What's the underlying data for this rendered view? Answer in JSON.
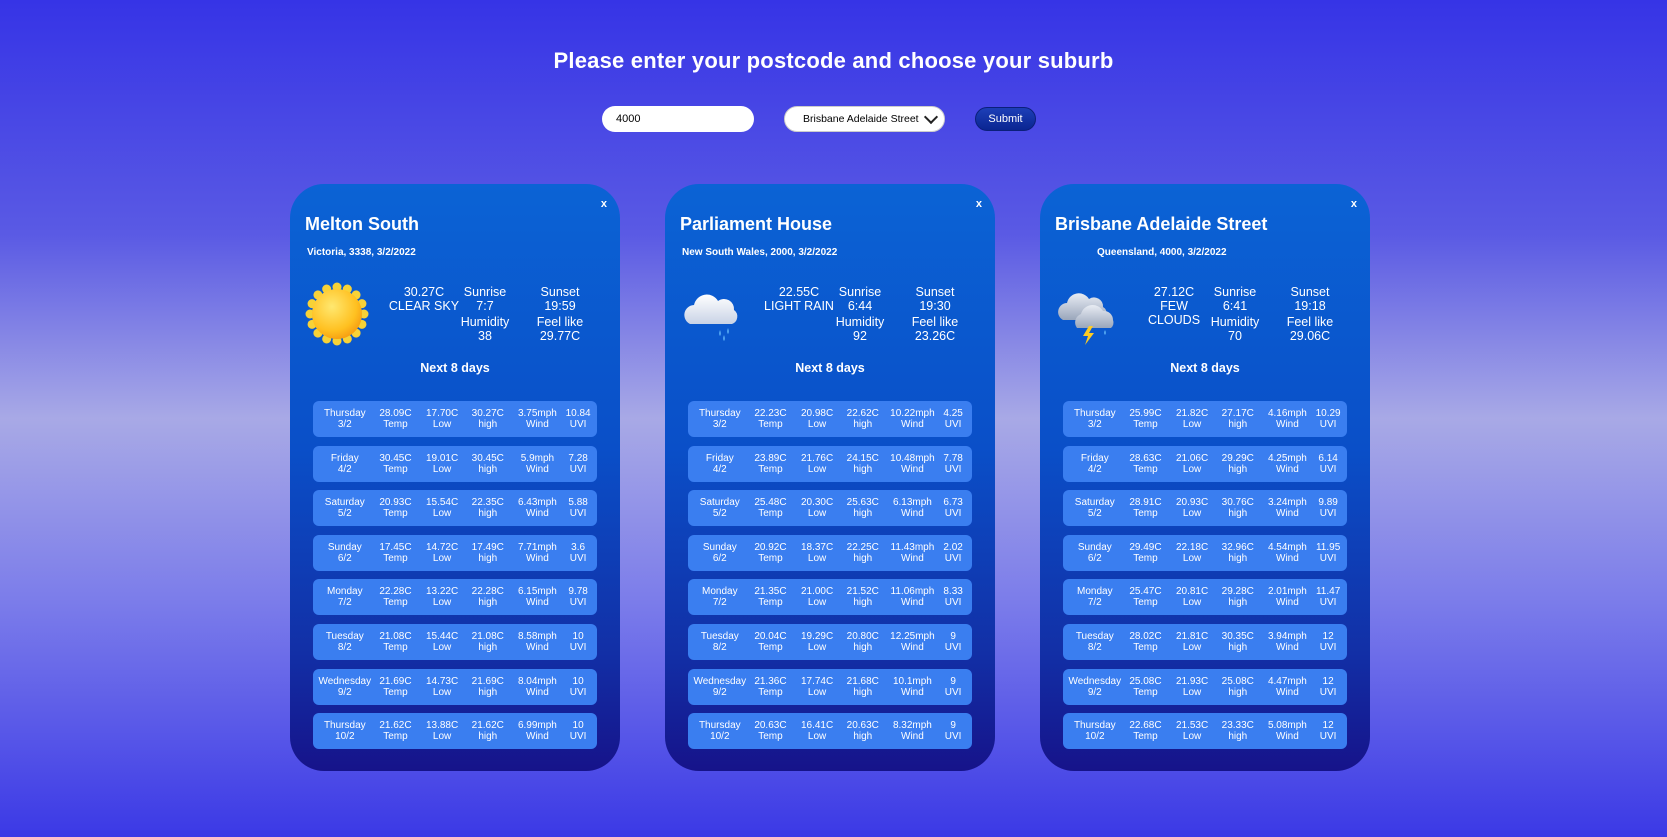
{
  "heading": "Please enter your postcode and choose your suburb",
  "form": {
    "postcode_value": "4000",
    "suburb_selected": "Brisbane Adelaide Street",
    "submit_label": "Submit"
  },
  "labels": {
    "next_title": "Next 8 days",
    "sunrise": "Sunrise",
    "sunset": "Sunset",
    "humidity": "Humidity",
    "feel_like": "Feel like",
    "close": "x",
    "temp": "Temp",
    "low": "Low",
    "high": "high",
    "wind": "Wind",
    "uvi": "UVI"
  },
  "cards": [
    {
      "city": "Melton South",
      "meta": "Victoria, 3338, 3/2/2022",
      "icon": "sun-icon",
      "temp": "30.27C",
      "desc": "CLEAR SKY",
      "sunrise": "7:7",
      "sunset": "19:59",
      "humidity": "38",
      "feel_like": "29.77C",
      "days": [
        {
          "day": "Thursday",
          "date": "3/2",
          "temp": "28.09C",
          "low": "17.70C",
          "high": "30.27C",
          "wind": "3.75mph",
          "uvi": "10.84"
        },
        {
          "day": "Friday",
          "date": "4/2",
          "temp": "30.45C",
          "low": "19.01C",
          "high": "30.45C",
          "wind": "5.9mph",
          "uvi": "7.28"
        },
        {
          "day": "Saturday",
          "date": "5/2",
          "temp": "20.93C",
          "low": "15.54C",
          "high": "22.35C",
          "wind": "6.43mph",
          "uvi": "5.88"
        },
        {
          "day": "Sunday",
          "date": "6/2",
          "temp": "17.45C",
          "low": "14.72C",
          "high": "17.49C",
          "wind": "7.71mph",
          "uvi": "3.6"
        },
        {
          "day": "Monday",
          "date": "7/2",
          "temp": "22.28C",
          "low": "13.22C",
          "high": "22.28C",
          "wind": "6.15mph",
          "uvi": "9.78"
        },
        {
          "day": "Tuesday",
          "date": "8/2",
          "temp": "21.08C",
          "low": "15.44C",
          "high": "21.08C",
          "wind": "8.58mph",
          "uvi": "10"
        },
        {
          "day": "Wednesday",
          "date": "9/2",
          "temp": "21.69C",
          "low": "14.73C",
          "high": "21.69C",
          "wind": "8.04mph",
          "uvi": "10"
        },
        {
          "day": "Thursday",
          "date": "10/2",
          "temp": "21.62C",
          "low": "13.88C",
          "high": "21.62C",
          "wind": "6.99mph",
          "uvi": "10"
        }
      ]
    },
    {
      "city": "Parliament House",
      "meta": "New South Wales, 2000, 3/2/2022",
      "icon": "rain-cloud-icon",
      "temp": "22.55C",
      "desc": "LIGHT RAIN",
      "sunrise": "6:44",
      "sunset": "19:30",
      "humidity": "92",
      "feel_like": "23.26C",
      "days": [
        {
          "day": "Thursday",
          "date": "3/2",
          "temp": "22.23C",
          "low": "20.98C",
          "high": "22.62C",
          "wind": "10.22mph",
          "uvi": "4.25"
        },
        {
          "day": "Friday",
          "date": "4/2",
          "temp": "23.89C",
          "low": "21.76C",
          "high": "24.15C",
          "wind": "10.48mph",
          "uvi": "7.78"
        },
        {
          "day": "Saturday",
          "date": "5/2",
          "temp": "25.48C",
          "low": "20.30C",
          "high": "25.63C",
          "wind": "6.13mph",
          "uvi": "6.73"
        },
        {
          "day": "Sunday",
          "date": "6/2",
          "temp": "20.92C",
          "low": "18.37C",
          "high": "22.25C",
          "wind": "11.43mph",
          "uvi": "2.02"
        },
        {
          "day": "Monday",
          "date": "7/2",
          "temp": "21.35C",
          "low": "21.00C",
          "high": "21.52C",
          "wind": "11.06mph",
          "uvi": "8.33"
        },
        {
          "day": "Tuesday",
          "date": "8/2",
          "temp": "20.04C",
          "low": "19.29C",
          "high": "20.80C",
          "wind": "12.25mph",
          "uvi": "9"
        },
        {
          "day": "Wednesday",
          "date": "9/2",
          "temp": "21.36C",
          "low": "17.74C",
          "high": "21.68C",
          "wind": "10.1mph",
          "uvi": "9"
        },
        {
          "day": "Thursday",
          "date": "10/2",
          "temp": "20.63C",
          "low": "16.41C",
          "high": "20.63C",
          "wind": "8.32mph",
          "uvi": "9"
        }
      ]
    },
    {
      "city": "Brisbane Adelaide Street",
      "meta": "Queensland, 4000, 3/2/2022",
      "icon": "storm-cloud-icon",
      "temp": "27.12C",
      "desc": "FEW CLOUDS",
      "sunrise": "6:41",
      "sunset": "19:18",
      "humidity": "70",
      "feel_like": "29.06C",
      "days": [
        {
          "day": "Thursday",
          "date": "3/2",
          "temp": "25.99C",
          "low": "21.82C",
          "high": "27.17C",
          "wind": "4.16mph",
          "uvi": "10.29"
        },
        {
          "day": "Friday",
          "date": "4/2",
          "temp": "28.63C",
          "low": "21.06C",
          "high": "29.29C",
          "wind": "4.25mph",
          "uvi": "6.14"
        },
        {
          "day": "Saturday",
          "date": "5/2",
          "temp": "28.91C",
          "low": "20.93C",
          "high": "30.76C",
          "wind": "3.24mph",
          "uvi": "9.89"
        },
        {
          "day": "Sunday",
          "date": "6/2",
          "temp": "29.49C",
          "low": "22.18C",
          "high": "32.96C",
          "wind": "4.54mph",
          "uvi": "11.95"
        },
        {
          "day": "Monday",
          "date": "7/2",
          "temp": "25.47C",
          "low": "20.81C",
          "high": "29.28C",
          "wind": "2.01mph",
          "uvi": "11.47"
        },
        {
          "day": "Tuesday",
          "date": "8/2",
          "temp": "28.02C",
          "low": "21.81C",
          "high": "30.35C",
          "wind": "3.94mph",
          "uvi": "12"
        },
        {
          "day": "Wednesday",
          "date": "9/2",
          "temp": "25.08C",
          "low": "21.93C",
          "high": "25.08C",
          "wind": "4.47mph",
          "uvi": "12"
        },
        {
          "day": "Thursday",
          "date": "10/2",
          "temp": "22.68C",
          "low": "21.53C",
          "high": "23.33C",
          "wind": "5.08mph",
          "uvi": "12"
        }
      ]
    }
  ]
}
